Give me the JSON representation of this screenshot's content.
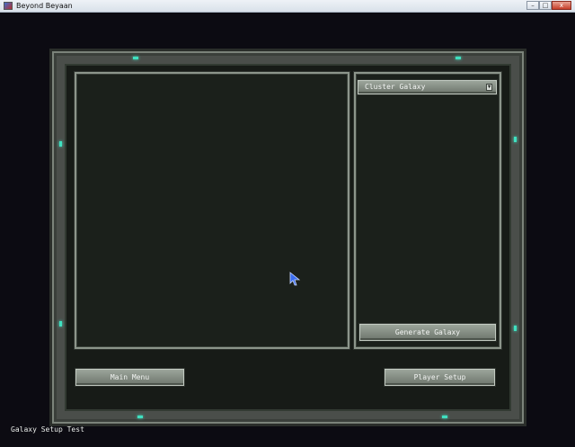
{
  "window": {
    "title": "Beyond Beyaan",
    "minimize": "–",
    "maximize": "□",
    "close": "x"
  },
  "galaxy_panel": {
    "type_dropdown": "Cluster Galaxy",
    "generate_button": "Generate Galaxy"
  },
  "footer": {
    "main_menu_button": "Main Menu",
    "player_setup_button": "Player Setup"
  },
  "status_text": "Galaxy Setup Test",
  "colors": {
    "frame": "#4a4e4a",
    "panel_bg": "#1b201b",
    "led": "#3fe0c0",
    "button": "#8a9389"
  }
}
